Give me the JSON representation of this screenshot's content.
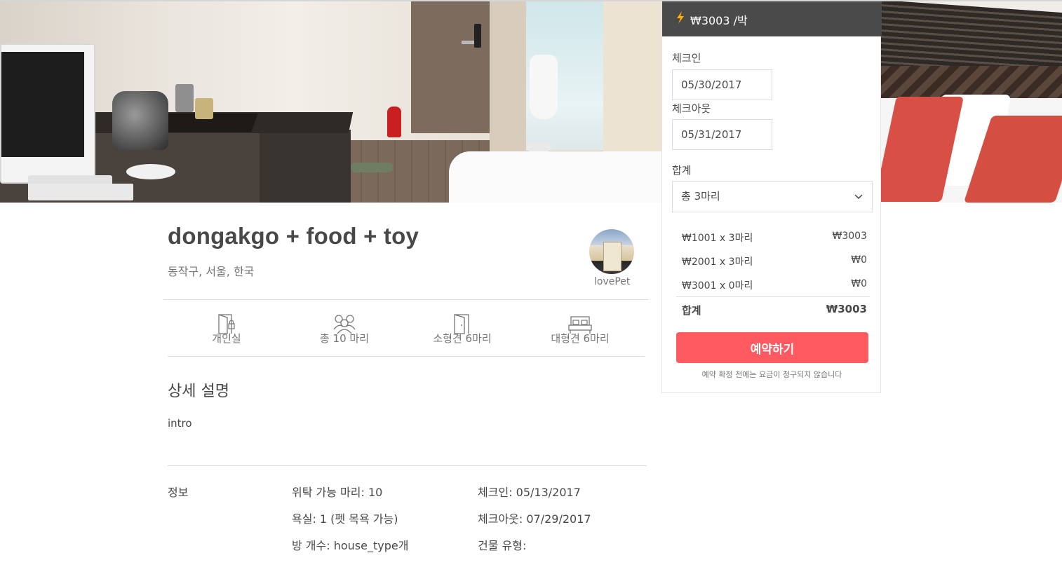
{
  "listing": {
    "title": "dongakgo + food + toy",
    "location": "동작구, 서울, 한국",
    "host_name": "lovePet"
  },
  "amenities": [
    {
      "icon": "door-lock-icon",
      "label": "개인실"
    },
    {
      "icon": "group-icon",
      "label": "총 10 마리"
    },
    {
      "icon": "door-icon",
      "label": "소형견 6마리"
    },
    {
      "icon": "bed-icon",
      "label": "대형견 6마리"
    }
  ],
  "description": {
    "heading": "상세 설명",
    "text": "intro"
  },
  "info": {
    "label": "정보",
    "capacity": "위탁 가능 마리: 10",
    "bath": "욕실: 1 (펫 목욕 가능)",
    "rooms": "방 개수: house_type개",
    "checkin": "체크인: 05/13/2017",
    "checkout": "체크아웃: 07/29/2017",
    "building": "건물 유형:"
  },
  "booking": {
    "price_per_night": "₩3003 /박",
    "checkin_label": "체크인",
    "checkin_value": "05/30/2017",
    "checkout_label": "체크아웃",
    "checkout_value": "05/31/2017",
    "total_label": "합계",
    "select_value": "총 3마리",
    "lines": [
      {
        "label": "₩1001 x 3마리",
        "amount": "₩3003"
      },
      {
        "label": "₩2001 x 3마리",
        "amount": "₩0"
      },
      {
        "label": "₩3001 x 0마리",
        "amount": "₩0"
      }
    ],
    "sum_label": "합계",
    "sum_amount": "₩3003",
    "book_button": "예약하기",
    "note": "예약 확정 전에는 요금이 청구되지 않습니다",
    "accent_color": "#ff5a5f",
    "header_color": "#4a4a4a",
    "bolt_color": "#ffb400"
  }
}
